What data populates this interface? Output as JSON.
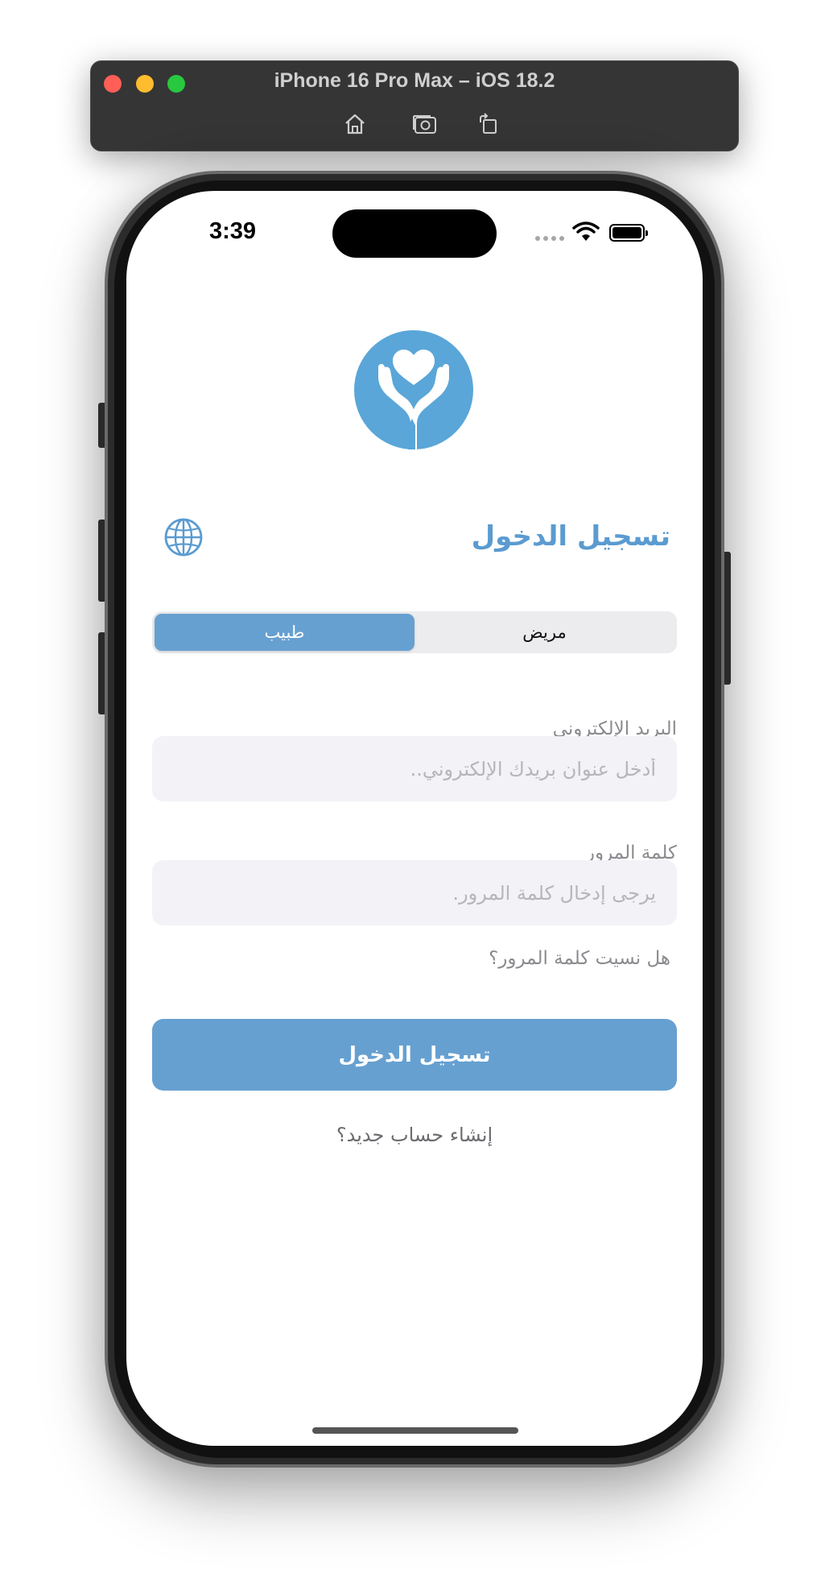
{
  "simulator": {
    "title": "iPhone 16 Pro Max – iOS 18.2",
    "toolbar": {
      "home_icon": "home-icon",
      "screenshot_icon": "camera-icon",
      "rotate_icon": "rotate-icon"
    }
  },
  "status_bar": {
    "time": "3:39",
    "icons": [
      "signal-dots-icon",
      "wifi-icon",
      "battery-icon"
    ]
  },
  "header": {
    "title": "تسجيل الدخول",
    "language_icon": "globe-icon"
  },
  "role_selector": {
    "options": [
      "طبيب",
      "مريض"
    ],
    "selected": "طبيب"
  },
  "form": {
    "email": {
      "label": "البريد الإلكتروني",
      "placeholder": "أدخل عنوان بريدك الإلكتروني..",
      "value": ""
    },
    "password": {
      "label": "كلمة المرور",
      "placeholder": "يرجى إدخال كلمة المرور.",
      "value": ""
    },
    "forgot_password": "هل نسيت كلمة المرور؟",
    "submit_label": "تسجيل الدخول",
    "create_account": "إنشاء حساب جديد؟"
  },
  "colors": {
    "accent": "#66a0d1",
    "title": "#5b9bd0",
    "logo": "#5aa6d8"
  }
}
